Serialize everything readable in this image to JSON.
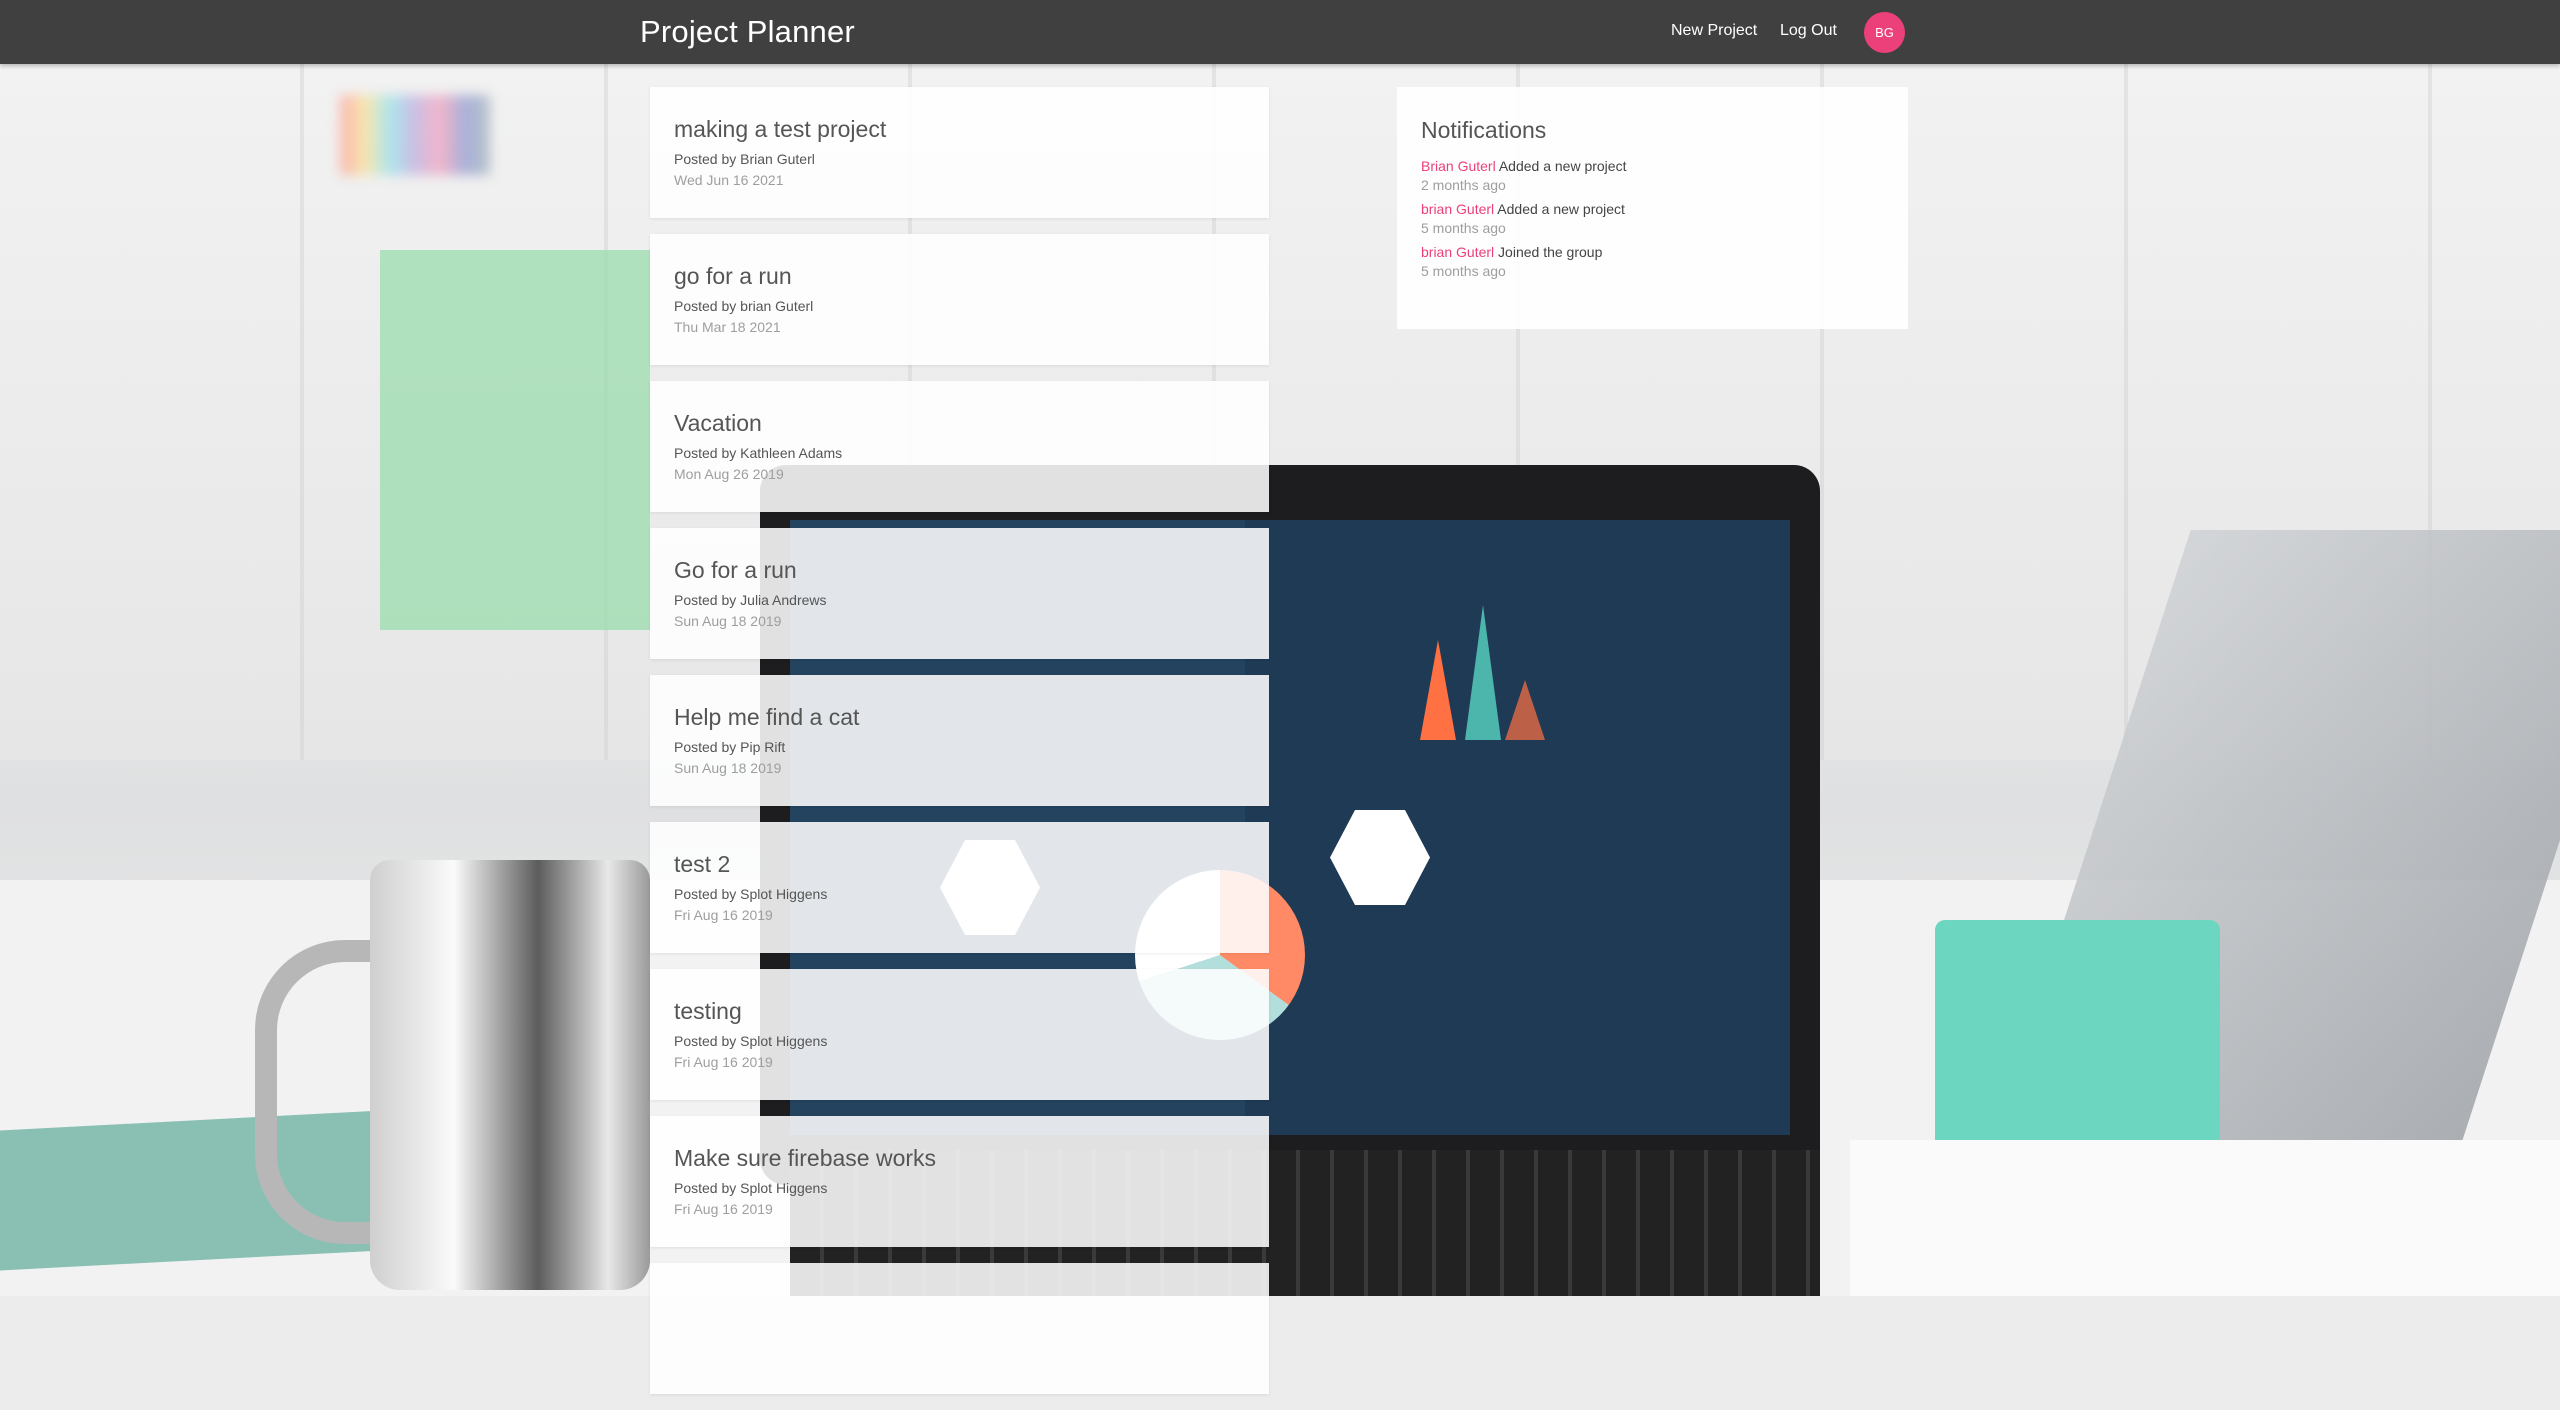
{
  "navbar": {
    "brand": "Project Planner",
    "links": {
      "new_project": "New Project",
      "logout": "Log Out"
    },
    "avatar_initials": "BG"
  },
  "projects": [
    {
      "title": "making a test project",
      "author": "Posted by Brian Guterl",
      "date": "Wed Jun 16 2021"
    },
    {
      "title": "go for a run",
      "author": "Posted by brian Guterl",
      "date": "Thu Mar 18 2021"
    },
    {
      "title": "Vacation",
      "author": "Posted by Kathleen Adams",
      "date": "Mon Aug 26 2019"
    },
    {
      "title": "Go for a run",
      "author": "Posted by Julia Andrews",
      "date": "Sun Aug 18 2019"
    },
    {
      "title": "Help me find a cat",
      "author": "Posted by Pip Rift",
      "date": "Sun Aug 18 2019"
    },
    {
      "title": "test 2",
      "author": "Posted by Splot Higgens",
      "date": "Fri Aug 16 2019"
    },
    {
      "title": "testing",
      "author": "Posted by Splot Higgens",
      "date": "Fri Aug 16 2019"
    },
    {
      "title": "Make sure firebase works",
      "author": "Posted by Splot Higgens",
      "date": "Fri Aug 16 2019"
    }
  ],
  "notifications": {
    "heading": "Notifications",
    "items": [
      {
        "user": "Brian Guterl",
        "action": "Added a new project",
        "time": "2 months ago"
      },
      {
        "user": "brian Guterl",
        "action": "Added a new project",
        "time": "5 months ago"
      },
      {
        "user": "brian Guterl",
        "action": "Joined the group",
        "time": "5 months ago"
      }
    ]
  },
  "colors": {
    "navbar": "#404040",
    "accent": "#ec407a",
    "card_bg": "rgba(255,255,255,0.87)"
  }
}
